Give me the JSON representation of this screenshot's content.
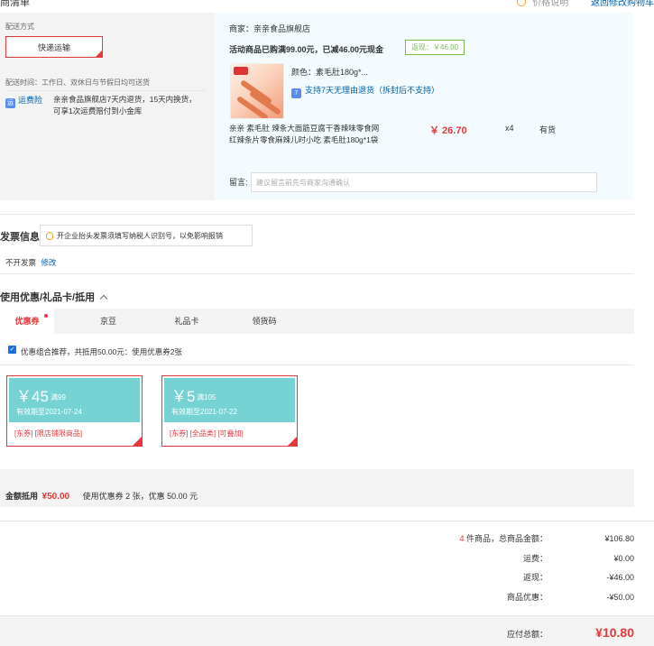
{
  "header": {
    "title_fragment": "商清单",
    "right_notice": "价格说明",
    "right_link": "返回修改购物车"
  },
  "shipping": {
    "label": "配送方式",
    "method": "快递运输",
    "time": "配送时间：工作日、双休日与节假日均可送货",
    "insurance_icon": "运",
    "insurance_label": "运费险",
    "insurance_desc_1": "亲亲食品旗舰店7天内退货，15天内换货，",
    "insurance_desc_2": "可享1次运费赔付到小金库"
  },
  "seller": {
    "name": "商家：亲亲食品旗舰店",
    "promo": "活动商品已购满99.00元，已减46.00元现金",
    "rebate_badge": "返现：￥46.00",
    "product": {
      "color": "颜色：素毛肚180g*...",
      "return_policy_icon": "7",
      "return_policy": "支持7天无理由退货（拆封后不支持）",
      "title_1": "亲亲 素毛肚 辣条大面筋豆腐干香辣味零食网",
      "title_2": "红辣条片零食麻辣儿时小吃 素毛肚180g*1袋",
      "price": "￥ 26.70",
      "qty": "x4",
      "stock": "有货"
    },
    "remark_label": "留言:",
    "remark_placeholder": "建议留言前先与商家沟通确认"
  },
  "invoice": {
    "title": "发票信息",
    "tip": "开企业抬头发票须填写纳税人识别号，以免影响报销",
    "type": "不开发票",
    "edit": "修改"
  },
  "coupons": {
    "title": "使用优惠/礼品卡/抵用",
    "tabs": [
      "优惠券",
      "京豆",
      "礼品卡",
      "领货码"
    ],
    "combo_text": "优惠组合推荐，共抵用50.00元：使用优惠券2张",
    "items": [
      {
        "amount": "￥45",
        "cond": "满99",
        "valid": "有效期至2021-07-24",
        "tags": "[东券] [限店铺限商品]"
      },
      {
        "amount": "￥5",
        "cond": "满105",
        "valid": "有效期至2021-07-22",
        "tags": "[东券] [全品类] [可叠加]"
      }
    ],
    "footer_label": "金额抵用",
    "footer_amount": "¥50.00",
    "footer_desc": "使用优惠券 2 张，优惠 50.00 元"
  },
  "summary": {
    "items_count": "4",
    "items_label": "件商品，总商品金额：",
    "items_total": "¥106.80",
    "freight_label": "运费：",
    "freight": "¥0.00",
    "rebate_label": "返现：",
    "rebate": "-¥46.00",
    "discount_label": "商品优惠：",
    "discount": "-¥50.00",
    "payable_label": "应付总额：",
    "payable": "¥10.80"
  },
  "colors": {
    "accent_red": "#e4393c",
    "link_blue": "#005ea7",
    "coupon_teal": "#77d2d3",
    "rebate_green": "#7abd54"
  }
}
